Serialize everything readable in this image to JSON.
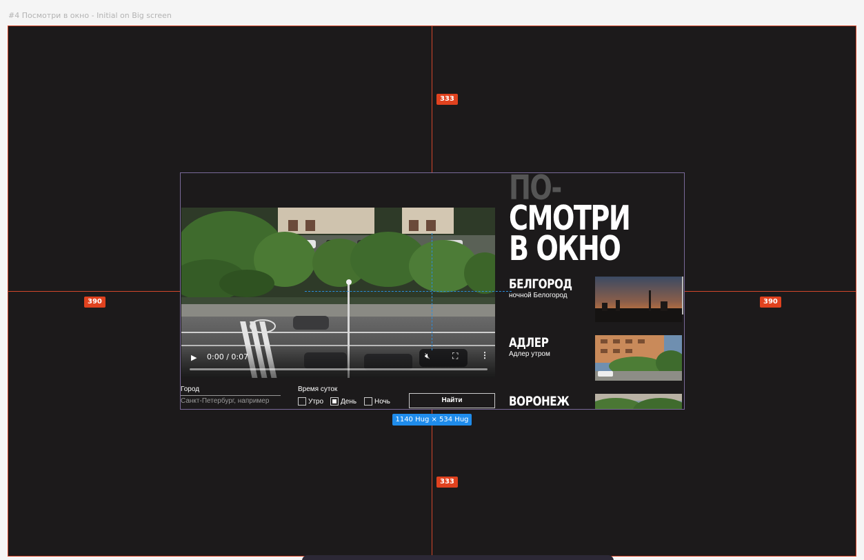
{
  "frame_title": "#4 Посмотри в окно - Initial on Big screen",
  "measures": {
    "top": "333",
    "bottom": "333",
    "left": "390",
    "right": "390",
    "size": "1140 Hug × 534 Hug"
  },
  "hero": {
    "title_line1": "ПО-",
    "title_line2": "СМОТРИ",
    "title_line3": "В ОКНО"
  },
  "video": {
    "time": "0:00 / 0:07",
    "progress": 0.0,
    "play_icon": "play-icon",
    "mute_icon": "mute-icon",
    "fullscreen_icon": "fullscreen-icon",
    "more_icon": "more-icon"
  },
  "cities": [
    {
      "name": "БЕЛГОРОД",
      "subtitle": "ночной Белогород"
    },
    {
      "name": "АДЛЕР",
      "subtitle": "Адлер утром"
    },
    {
      "name": "ВОРОНЕЖ",
      "subtitle": ""
    }
  ],
  "form": {
    "city_label": "Город",
    "city_placeholder": "Санкт-Петербург, например",
    "time_label": "Время суток",
    "options": [
      {
        "label": "Утро",
        "checked": false
      },
      {
        "label": "День",
        "checked": true
      },
      {
        "label": "Ночь",
        "checked": false
      }
    ],
    "submit": "Найти"
  },
  "colors": {
    "frame_bg": "#1c1a1b",
    "guide": "#d4472b",
    "measure_badge": "#e0421f",
    "selection": "#1f8ceb",
    "title_dim": "#555555"
  }
}
